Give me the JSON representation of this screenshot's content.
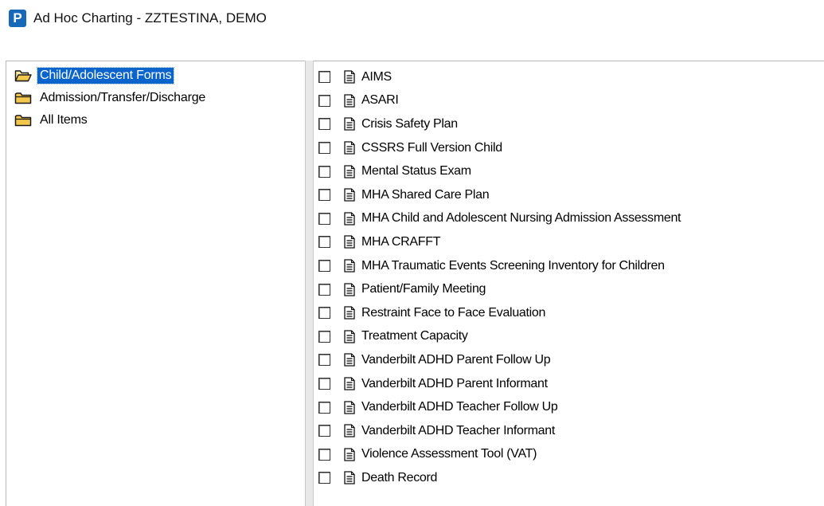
{
  "window": {
    "app_icon_letter": "P",
    "title": "Ad Hoc Charting - ZZTESTINA, DEMO"
  },
  "folders": [
    {
      "label": "Child/Adolescent Forms",
      "icon": "folder-open-icon",
      "selected": true
    },
    {
      "label": "Admission/Transfer/Discharge",
      "icon": "folder-icon",
      "selected": false
    },
    {
      "label": "All Items",
      "icon": "folder-icon",
      "selected": false
    }
  ],
  "forms": [
    {
      "label": "AIMS",
      "checked": false
    },
    {
      "label": "ASARI",
      "checked": false
    },
    {
      "label": "Crisis Safety Plan",
      "checked": false
    },
    {
      "label": "CSSRS Full Version Child",
      "checked": false
    },
    {
      "label": "Mental Status Exam",
      "checked": false
    },
    {
      "label": "MHA Shared Care Plan",
      "checked": false
    },
    {
      "label": "MHA Child and Adolescent Nursing Admission Assessment",
      "checked": false
    },
    {
      "label": "MHA CRAFFT",
      "checked": false
    },
    {
      "label": "MHA Traumatic Events Screening Inventory for Children",
      "checked": false
    },
    {
      "label": "Patient/Family Meeting",
      "checked": false
    },
    {
      "label": "Restraint Face to Face Evaluation",
      "checked": false
    },
    {
      "label": "Treatment Capacity",
      "checked": false
    },
    {
      "label": "Vanderbilt ADHD Parent Follow Up",
      "checked": false
    },
    {
      "label": "Vanderbilt ADHD Parent Informant",
      "checked": false
    },
    {
      "label": "Vanderbilt ADHD Teacher Follow Up",
      "checked": false
    },
    {
      "label": "Vanderbilt ADHD Teacher Informant",
      "checked": false
    },
    {
      "label": "Violence Assessment Tool (VAT)",
      "checked": false
    },
    {
      "label": "Death Record",
      "checked": false
    }
  ],
  "colors": {
    "app_icon": "#1668b8",
    "selection": "#0a64cc",
    "folder_fill": "#f3c74b",
    "folder_stroke": "#1a1a1a"
  }
}
